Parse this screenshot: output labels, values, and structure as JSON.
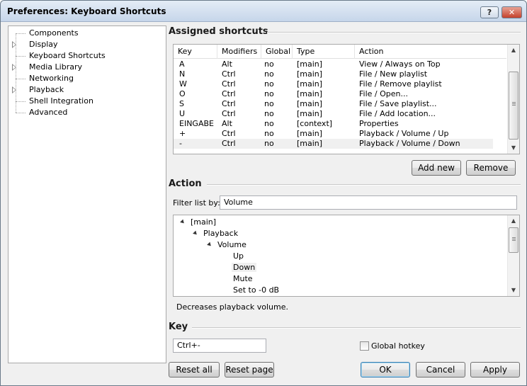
{
  "window": {
    "title": "Preferences: Keyboard Shortcuts",
    "help_button": "?",
    "close_button": "✕"
  },
  "sidebar": {
    "items": [
      {
        "label": "Components",
        "expandable": false
      },
      {
        "label": "Display",
        "expandable": true
      },
      {
        "label": "Keyboard Shortcuts",
        "expandable": false,
        "selected": true
      },
      {
        "label": "Media Library",
        "expandable": true
      },
      {
        "label": "Networking",
        "expandable": false
      },
      {
        "label": "Playback",
        "expandable": true
      },
      {
        "label": "Shell Integration",
        "expandable": false
      },
      {
        "label": "Advanced",
        "expandable": false
      }
    ]
  },
  "assigned": {
    "heading": "Assigned shortcuts",
    "columns": [
      "Key",
      "Modifiers",
      "Global",
      "Type",
      "Action"
    ],
    "rows": [
      [
        "A",
        "Alt",
        "no",
        "[main]",
        "View / Always on Top"
      ],
      [
        "N",
        "Ctrl",
        "no",
        "[main]",
        "File / New playlist"
      ],
      [
        "W",
        "Ctrl",
        "no",
        "[main]",
        "File / Remove playlist"
      ],
      [
        "O",
        "Ctrl",
        "no",
        "[main]",
        "File / Open..."
      ],
      [
        "S",
        "Ctrl",
        "no",
        "[main]",
        "File / Save playlist..."
      ],
      [
        "U",
        "Ctrl",
        "no",
        "[main]",
        "File / Add location..."
      ],
      [
        "EINGABE",
        "Alt",
        "no",
        "[context]",
        "Properties"
      ],
      [
        "+",
        "Ctrl",
        "no",
        "[main]",
        "Playback / Volume / Up"
      ],
      [
        "-",
        "Ctrl",
        "no",
        "[main]",
        "Playback / Volume / Down"
      ]
    ],
    "selected_row": 8,
    "add_new": "Add new",
    "remove": "Remove"
  },
  "action": {
    "heading": "Action",
    "filter_label": "Filter list by:",
    "filter_value": "Volume",
    "tree": [
      {
        "label": "[main]",
        "level": 0,
        "expanded": true
      },
      {
        "label": "Playback",
        "level": 1,
        "expanded": true
      },
      {
        "label": "Volume",
        "level": 2,
        "expanded": true
      },
      {
        "label": "Up",
        "level": 3
      },
      {
        "label": "Down",
        "level": 3,
        "selected": true
      },
      {
        "label": "Mute",
        "level": 3
      },
      {
        "label": "Set to -0 dB",
        "level": 3
      }
    ],
    "description": "Decreases playback volume."
  },
  "key": {
    "heading": "Key",
    "value": "Ctrl+-",
    "global_hotkey_label": "Global hotkey",
    "global_hotkey_checked": false
  },
  "footer": {
    "reset_all": "Reset all",
    "reset_page": "Reset page",
    "ok": "OK",
    "cancel": "Cancel",
    "apply": "Apply"
  }
}
